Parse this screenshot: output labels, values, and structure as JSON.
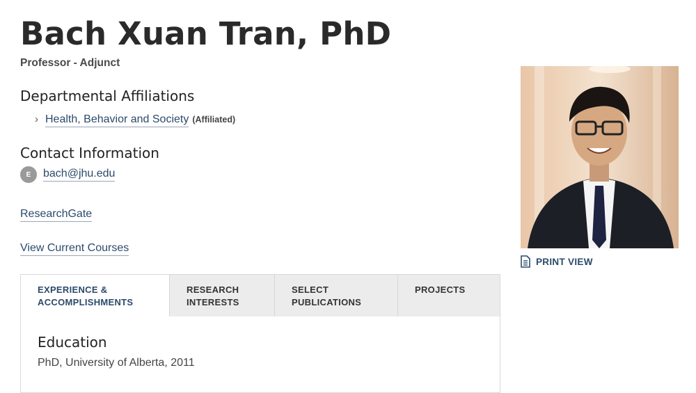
{
  "profile": {
    "name": "Bach Xuan Tran, PhD",
    "position": "Professor - Adjunct"
  },
  "affiliations": {
    "heading": "Departmental Affiliations",
    "items": [
      {
        "label": "Health, Behavior and Society",
        "tag": "(Affiliated)",
        "icon": "chevron-right-icon"
      }
    ]
  },
  "contact": {
    "heading": "Contact Information",
    "email_badge": "E",
    "email": "bach@jhu.edu"
  },
  "links": {
    "researchgate": "ResearchGate",
    "courses": "View Current Courses"
  },
  "sidebar": {
    "print_view": "PRINT VIEW",
    "print_icon": "document-icon"
  },
  "tabs": [
    {
      "line1": "EXPERIENCE &",
      "line2": "ACCOMPLISHMENTS",
      "active": true
    },
    {
      "line1": "RESEARCH",
      "line2": "INTERESTS",
      "active": false
    },
    {
      "line1": "SELECT",
      "line2": "PUBLICATIONS",
      "active": false
    },
    {
      "line1": "PROJECTS",
      "line2": "",
      "active": false
    }
  ],
  "panel": {
    "heading": "Education",
    "text": "PhD, University of Alberta, 2011"
  },
  "colors": {
    "link": "#2b4a6b",
    "tab_bg": "#ececec",
    "badge": "#9a9a9a"
  }
}
